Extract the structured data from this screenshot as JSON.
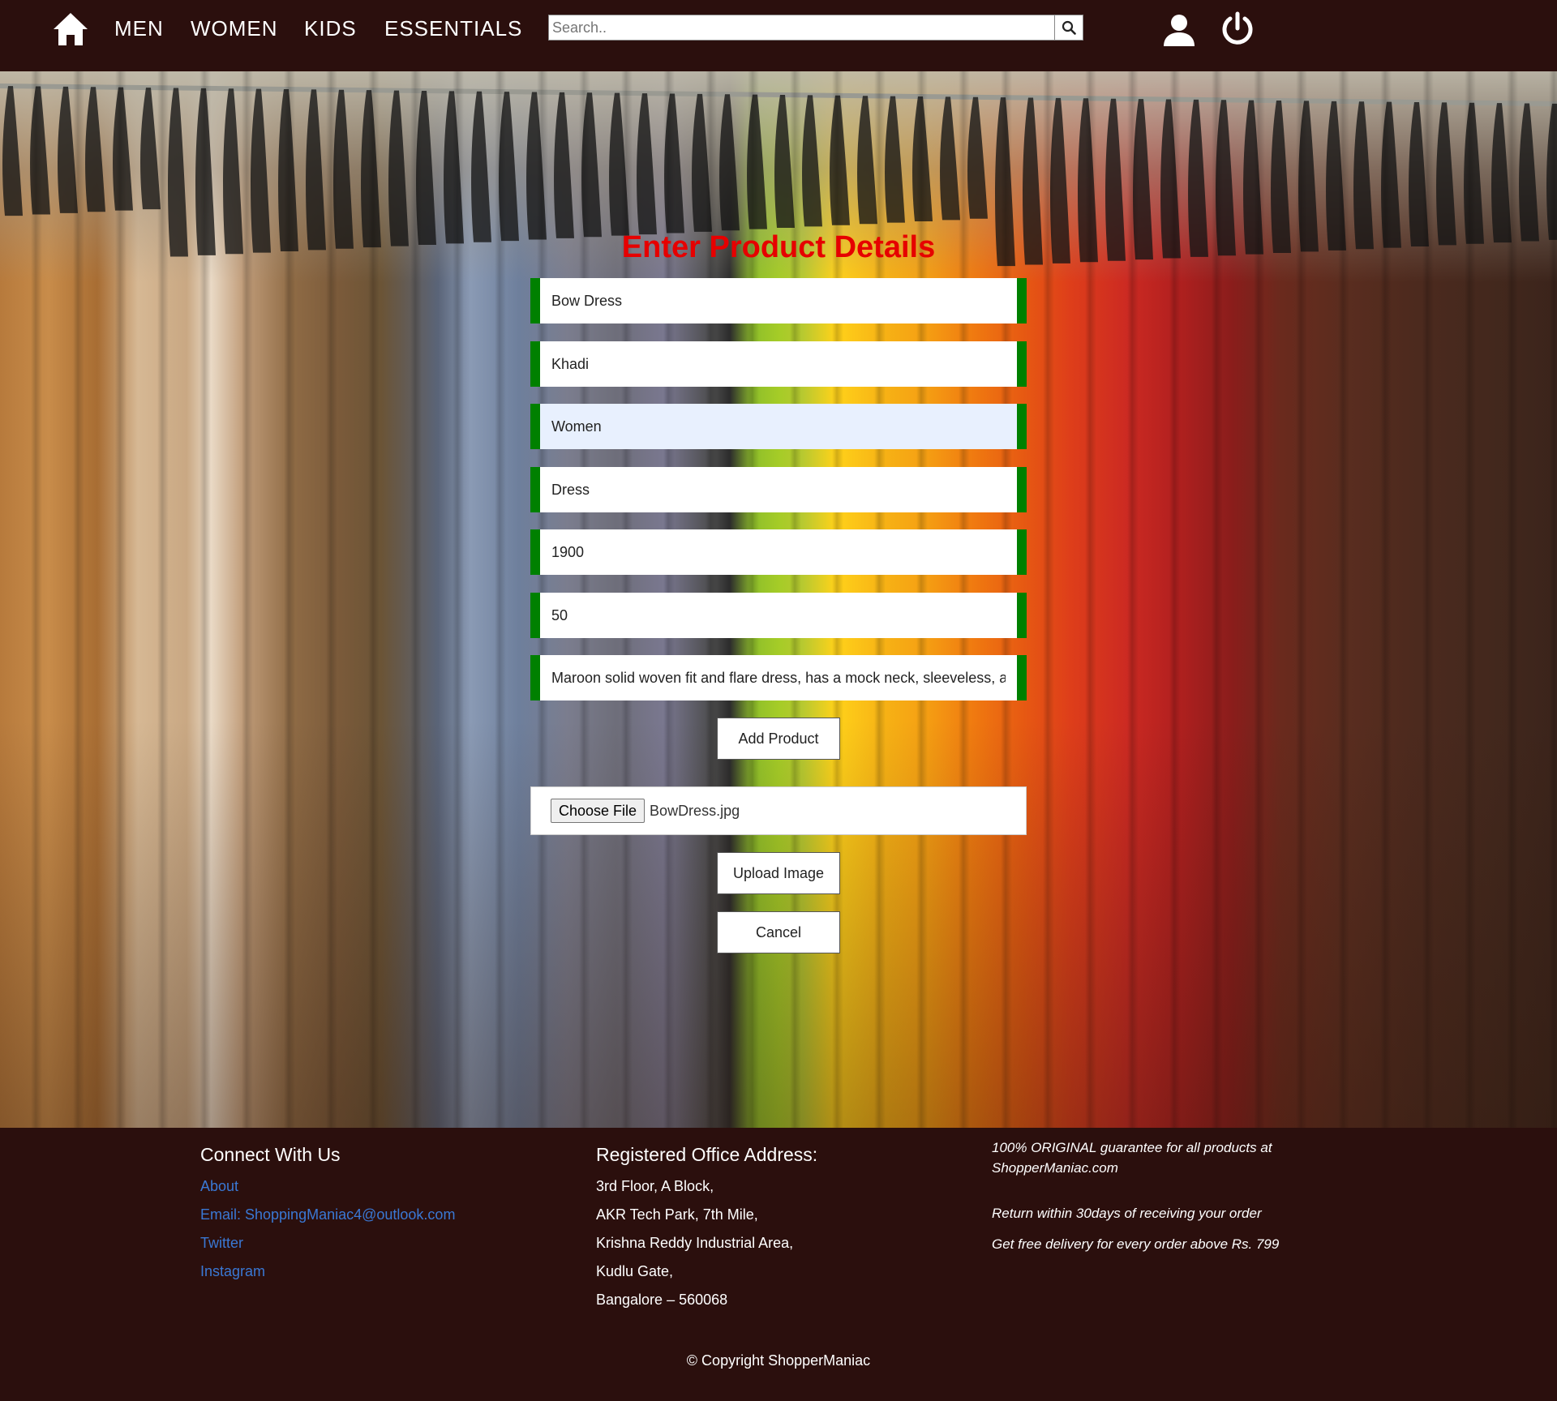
{
  "navbar": {
    "home_icon": "home-icon",
    "links": [
      "MEN",
      "WOMEN",
      "KIDS",
      "ESSENTIALS"
    ],
    "search": {
      "placeholder": "Search..",
      "value": "",
      "button_icon": "search-icon"
    },
    "user_icon": "user-icon",
    "power_icon": "power-icon"
  },
  "form": {
    "title": "Enter Product Details",
    "fields": {
      "name": "Bow Dress",
      "brand": "Khadi",
      "category": "Women",
      "type": "Dress",
      "price": "1900",
      "quantity": "50",
      "description": "Maroon solid woven fit and flare dress, has a mock neck, sleeveless, and"
    },
    "add_product_label": "Add Product",
    "choose_file_label": "Choose File",
    "file_name": "BowDress.jpg",
    "upload_image_label": "Upload Image",
    "cancel_label": "Cancel"
  },
  "footer": {
    "connect_heading": "Connect With Us",
    "links": {
      "about": "About",
      "email": "Email: ShoppingManiac4@outlook.com",
      "twitter": "Twitter",
      "instagram": "Instagram"
    },
    "address_heading": "Registered Office Address:",
    "address_lines": [
      "3rd Floor, A Block,",
      "AKR Tech Park, 7th Mile,",
      "Krishna Reddy Industrial Area,",
      "Kudlu Gate,",
      "Bangalore – 560068"
    ],
    "promos": {
      "guarantee": "100% ORIGINAL guarantee for all products at ShopperManiac.com",
      "return": "Return within 30days of receiving your order",
      "delivery": "Get free delivery for every order above Rs. 799"
    },
    "copyright": "© Copyright ShopperManiac"
  },
  "colors": {
    "navbar_bg": "#2b0f0d",
    "title_red": "#e60000",
    "field_accent_green": "#008000",
    "link_blue": "#3a78d4"
  }
}
